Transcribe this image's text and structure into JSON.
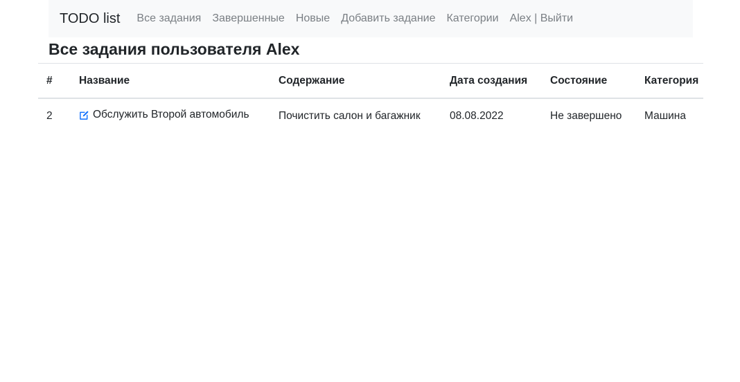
{
  "navbar": {
    "brand": "TODO list",
    "links": [
      {
        "label": "Все задания"
      },
      {
        "label": "Завершенные"
      },
      {
        "label": "Новые"
      },
      {
        "label": "Добавить задание"
      },
      {
        "label": "Категории"
      },
      {
        "label": "Alex | Выйти"
      }
    ]
  },
  "page": {
    "title": "Все задания пользователя Alex"
  },
  "table": {
    "headers": [
      "#",
      "Название",
      "Содержание",
      "Дата создания",
      "Состояние",
      "Категория"
    ],
    "rows": [
      {
        "num": "2",
        "title": "Обслужить Второй автомобиль",
        "content": "Почистить салон и багажник",
        "date": "08.08.2022",
        "status": "Не завершено",
        "category": "Машина"
      }
    ]
  },
  "colors": {
    "navbar_bg": "#f8f9fa",
    "nav_link": "#7a7f84",
    "edit_icon": "#0d6efd"
  },
  "icons": {
    "edit": "edit-icon"
  }
}
